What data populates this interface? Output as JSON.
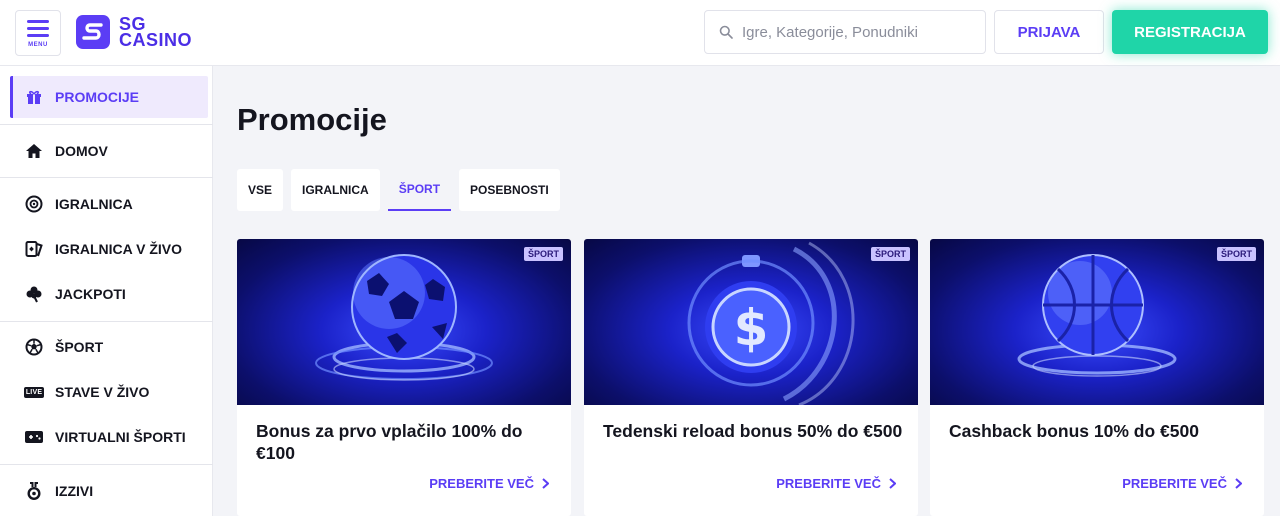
{
  "header": {
    "menu_label": "MENU",
    "logo_line1": "SG",
    "logo_line2": "CASINO",
    "search_placeholder": "Igre, Kategorije, Ponudniki",
    "login_label": "PRIJAVA",
    "register_label": "REGISTRACIJA"
  },
  "colors": {
    "brand": "#5b3df5",
    "register": "#1fd5a8",
    "promo_bg": "#1b22c9"
  },
  "sidebar": {
    "items": [
      {
        "label": "PROMOCIJE",
        "icon": "gift-icon",
        "active": true
      },
      {
        "label": "DOMOV",
        "icon": "home-icon"
      },
      {
        "label": "IGRALNICA",
        "icon": "casino-chip-icon"
      },
      {
        "label": "IGRALNICA V ŽIVO",
        "icon": "cards-icon"
      },
      {
        "label": "JACKPOTI",
        "icon": "clover-icon"
      },
      {
        "label": "ŠPORT",
        "icon": "soccer-ball-icon"
      },
      {
        "label": "STAVE V ŽIVO",
        "icon": "live-icon",
        "icon_text": "LIVE"
      },
      {
        "label": "VIRTUALNI ŠPORTI",
        "icon": "gamepad-icon"
      },
      {
        "label": "IZZIVI",
        "icon": "medal-icon"
      }
    ]
  },
  "main": {
    "title": "Promocije",
    "tabs": [
      {
        "label": "VSE"
      },
      {
        "label": "IGRALNICA"
      },
      {
        "label": "ŠPORT",
        "active": true
      },
      {
        "label": "POSEBNOSTI"
      }
    ],
    "cards": [
      {
        "badge": "ŠPORT",
        "title": "Bonus za prvo vplačilo 100% do €100",
        "link": "PREBERITE VEČ",
        "image": "soccer-ball"
      },
      {
        "badge": "ŠPORT",
        "title": "Tedenski reload bonus 50% do €500",
        "link": "PREBERITE VEČ",
        "image": "dollar-stopwatch"
      },
      {
        "badge": "ŠPORT",
        "title": "Cashback bonus 10% do €500",
        "link": "PREBERITE VEČ",
        "image": "basketball"
      }
    ]
  }
}
